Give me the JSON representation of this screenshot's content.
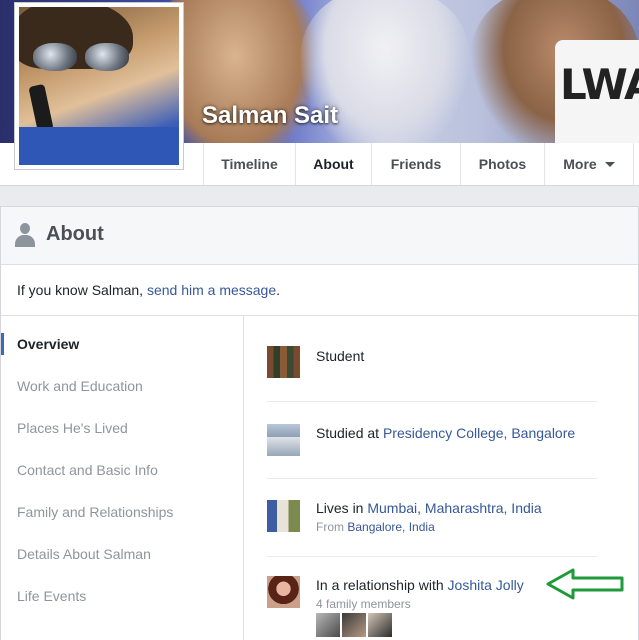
{
  "profile": {
    "name": "Salman Sait",
    "cover_text": "LWA"
  },
  "tabs": [
    {
      "label": "Timeline",
      "active": false
    },
    {
      "label": "About",
      "active": true
    },
    {
      "label": "Friends",
      "active": false
    },
    {
      "label": "Photos",
      "active": false
    },
    {
      "label": "More",
      "active": false
    }
  ],
  "about": {
    "title": "About",
    "message_prefix": "If you know Salman, ",
    "message_link": "send him a message",
    "message_suffix": "."
  },
  "nav": [
    {
      "label": "Overview",
      "active": true
    },
    {
      "label": "Work and Education",
      "active": false
    },
    {
      "label": "Places He's Lived",
      "active": false
    },
    {
      "label": "Contact and Basic Info",
      "active": false
    },
    {
      "label": "Family and Relationships",
      "active": false
    },
    {
      "label": "Details About Salman",
      "active": false
    },
    {
      "label": "Life Events",
      "active": false
    }
  ],
  "overview": {
    "student": "Student",
    "studied_prefix": "Studied at ",
    "studied_link": "Presidency College, Bangalore",
    "lives_prefix": "Lives in ",
    "lives_link": "Mumbai, Maharashtra, India",
    "from_prefix": "From ",
    "from_link": "Bangalore, India",
    "relationship_prefix": "In a relationship with ",
    "relationship_link": "Joshita Jolly",
    "family_count": "4 family members"
  },
  "colors": {
    "link": "#365899",
    "annotation_arrow": "#1f9a3a",
    "nav_marker": "#4267b2"
  }
}
